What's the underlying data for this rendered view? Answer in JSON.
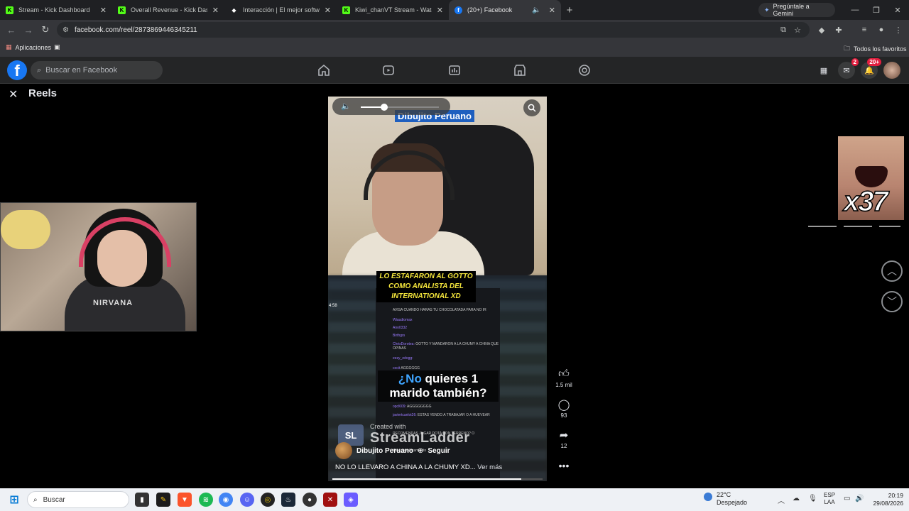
{
  "browser": {
    "tabs": [
      {
        "title": "Stream - Kick Dashboard",
        "favicon": "kick-icon",
        "color": "#53fc18",
        "active": false
      },
      {
        "title": "Overall Revenue - Kick Dashbo",
        "favicon": "kick-icon",
        "color": "#53fc18",
        "active": false
      },
      {
        "title": "Interacción | El mejor software",
        "favicon": "diamond-icon",
        "color": "#ffffff",
        "active": false
      },
      {
        "title": "Kiwi_chanVT Stream - Watch Li",
        "favicon": "kick-icon",
        "color": "#53fc18",
        "active": false
      },
      {
        "title": "(20+) Facebook",
        "favicon": "facebook-icon",
        "color": "#1877f2",
        "active": true
      }
    ],
    "gemini_label": "Pregúntale a Gemini",
    "url": "facebook.com/reel/2873869446345211",
    "bookmarks": {
      "apps_label": "Aplicaciones",
      "all_favorites_label": "Todos los favoritos"
    }
  },
  "facebook": {
    "logo_letter": "f",
    "search_placeholder": "Buscar en Facebook",
    "messenger_badge": "2",
    "notifications_badge": "20+"
  },
  "reels": {
    "title": "Reels",
    "volume_level": 0.3,
    "video": {
      "name_banner": "Dibujito Peruano",
      "headline": "LO ESTAFARON AL GOTTO COMO ANALISTA DEL INTERNATIONAL XD",
      "question_accent": "¿No",
      "question_rest": " quieres 1 marido también?",
      "watermark_small": "Created with",
      "watermark_big": "StreamLadder",
      "watermark_badge": "SL",
      "chat_time": "4:58",
      "chat_lines": [
        {
          "user": "",
          "text": "AVISA CUANDO HARAS TU CHOCOLATADA PARA NO IR"
        },
        {
          "user": "Wiaudiomax",
          "text": ""
        },
        {
          "user": "Ano0332",
          "text": ""
        },
        {
          "user": "Birthgrs",
          "text": ""
        },
        {
          "user": "ChrisDorotea:",
          "text": "GOTTO Y MANDARON A LA CHUMY A CHINA QUE OPINAS"
        },
        {
          "user": "eezy_edogg:",
          "text": ""
        },
        {
          "user": "cocit",
          "text": "AGGGGGG"
        },
        {
          "user": "opcl609:",
          "text": "AGGGGGGGG"
        },
        {
          "user": "javiertcanlot26:",
          "text": "ESTAS YENDO A TRABAJAR O A HUEVEAR"
        },
        {
          "user": "",
          "text": "RECOMENDAS JUGAR DOTA CON TERRENO? O"
        },
        {
          "user": "",
          "text": "tiene desplazamiento"
        }
      ],
      "author": "Dibujito Peruano",
      "follow_label": "Seguir",
      "caption": "NO LO LLEVARO A CHINA A LA CHUMY XD...",
      "see_more": "Ver más",
      "progress": 0.9
    },
    "actions": {
      "likes": "1.5 mil",
      "comments": "93",
      "shares": "12"
    }
  },
  "overlays": {
    "webcam_shirt_text": "NIRVANA",
    "meme_count": "x37"
  },
  "taskbar": {
    "search_placeholder": "Buscar",
    "weather_temp": "22°C",
    "weather_desc": "Despejado",
    "lang_top": "ESP",
    "lang_bottom": "LAA",
    "time": "20:19",
    "date": "29/08/2026"
  }
}
